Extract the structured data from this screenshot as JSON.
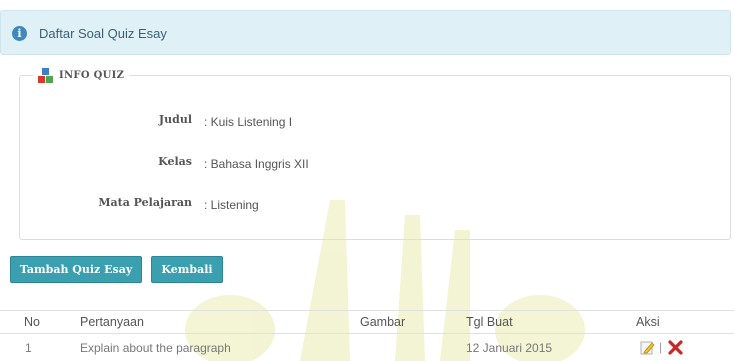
{
  "alert": {
    "icon": "info-icon",
    "text": "Daftar Soal Quiz Esay"
  },
  "info_quiz": {
    "legend": "INFO QUIZ",
    "icon": "blocks-icon",
    "rows": [
      {
        "label": "Judul",
        "value": ": Kuis Listening I"
      },
      {
        "label": "Kelas",
        "value": ": Bahasa Inggris XII"
      },
      {
        "label": "Mata Pelajaran",
        "value": ": Listening"
      }
    ]
  },
  "buttons": {
    "add": "Tambah Quiz Esay",
    "back": "Kembali"
  },
  "table": {
    "headers": [
      "No",
      "Pertanyaan",
      "Gambar",
      "Tgl Buat",
      "Aksi"
    ],
    "rows": [
      {
        "no": "1",
        "question": "Explain about the paragraph",
        "image": "",
        "date": "12 Januari 2015",
        "separator": "|"
      }
    ],
    "actions": [
      "edit-icon",
      "delete-icon"
    ]
  },
  "colors": {
    "button": "#3a9faf",
    "alert_bg": "#dff0f6",
    "delete": "#c62828",
    "edit": "#e6b800"
  }
}
